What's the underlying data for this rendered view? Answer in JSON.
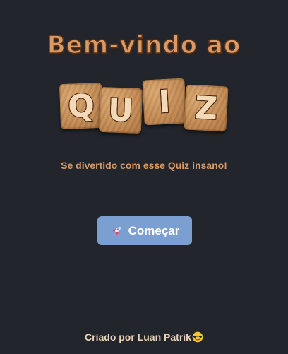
{
  "header": {
    "welcome_title": "Bem-vindo ao",
    "tiles": [
      "Q",
      "U",
      "I",
      "Z"
    ]
  },
  "main": {
    "subtitle": "Se divertido com esse Quiz insano!",
    "start_button_label": "Começar",
    "start_button_icon": "rocket-icon"
  },
  "footer": {
    "credit": "Criado por Luan Patrik",
    "credit_icon": "smiling-face-with-sunglasses-icon"
  },
  "colors": {
    "background": "#22262c",
    "accent": "#d99a66",
    "button": "#7a9fd0",
    "tile_wood": "#c18a55"
  }
}
